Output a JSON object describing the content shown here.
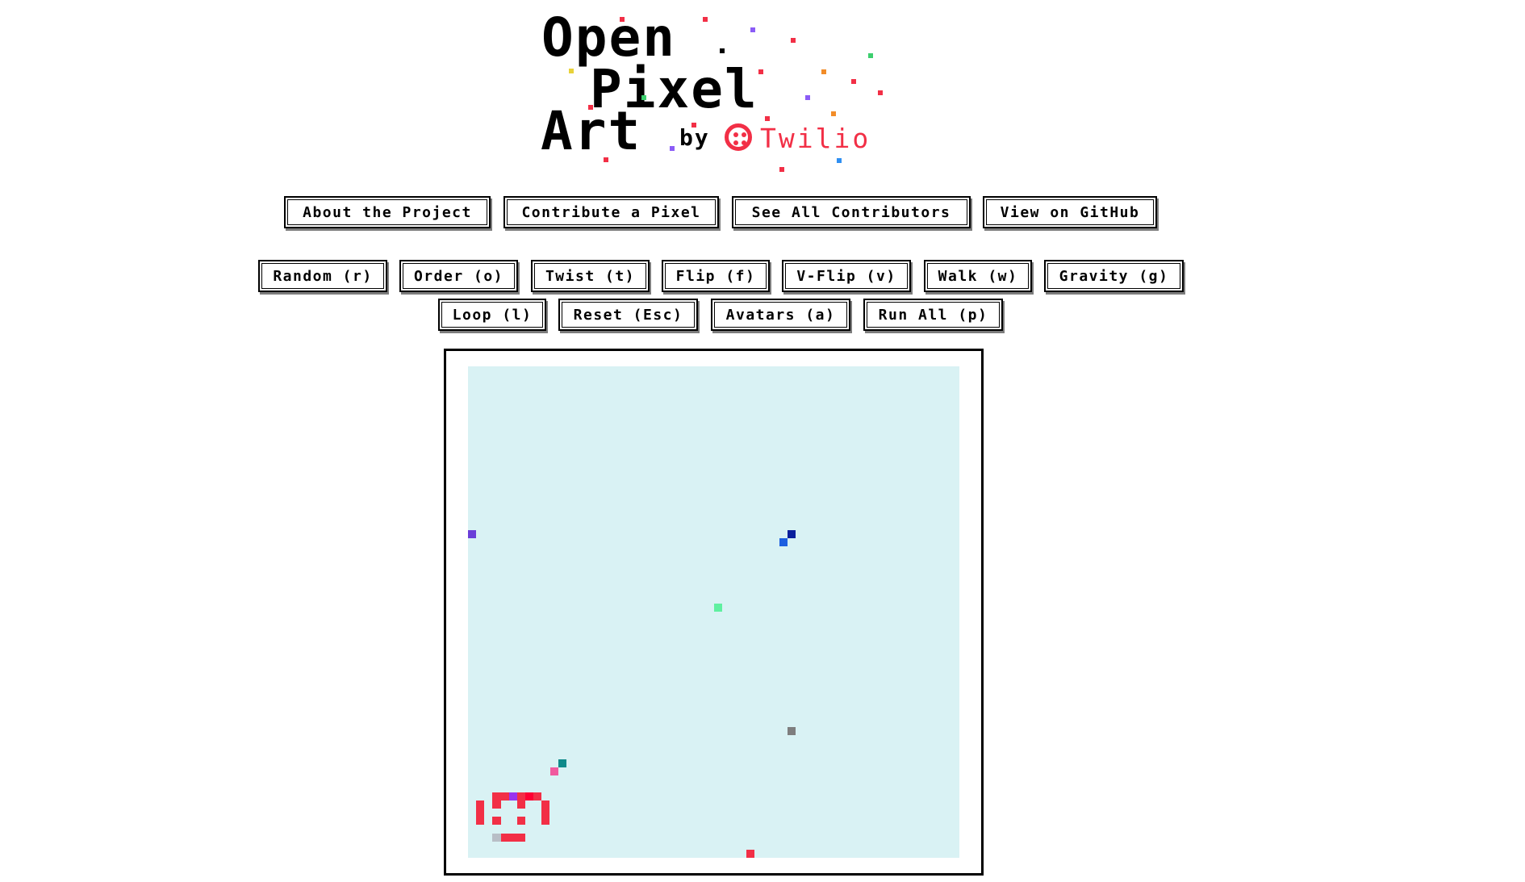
{
  "logo": {
    "line1": "Open",
    "line2": "Pixel",
    "line3": "Art",
    "by": "by",
    "brand": "Twilio",
    "brand_color": "#f22f46",
    "brand_icon": "twilio-logo-icon"
  },
  "nav": {
    "about": "About the Project",
    "contribute": "Contribute a Pixel",
    "contributors": "See All Contributors",
    "github": "View on GitHub"
  },
  "controls": {
    "random": "Random (r)",
    "order": "Order (o)",
    "twist": "Twist (t)",
    "flip": "Flip (f)",
    "vflip": "V-Flip (v)",
    "walk": "Walk (w)",
    "gravity": "Gravity (g)",
    "loop": "Loop (l)",
    "reset": "Reset (Esc)",
    "avatars": "Avatars (a)",
    "run_all": "Run All (p)"
  },
  "canvas": {
    "background": "#d9f2f4",
    "grid_cells": 60,
    "pixels": [
      {
        "col": 0,
        "row": 20,
        "color": "#6a3fd8"
      },
      {
        "col": 39,
        "row": 20,
        "color": "#0a1f9c"
      },
      {
        "col": 38,
        "row": 21,
        "color": "#1c5fe0"
      },
      {
        "col": 30,
        "row": 29,
        "color": "#5ff0a0"
      },
      {
        "col": 39,
        "row": 44,
        "color": "#7e7e7e"
      },
      {
        "col": 11,
        "row": 48,
        "color": "#0f8a8a"
      },
      {
        "col": 10,
        "row": 49,
        "color": "#f05a9e"
      },
      {
        "col": 3,
        "row": 52,
        "color": "#f22f46"
      },
      {
        "col": 4,
        "row": 52,
        "color": "#f22f46"
      },
      {
        "col": 5,
        "row": 52,
        "color": "#9933ee"
      },
      {
        "col": 6,
        "row": 52,
        "color": "#f22f46"
      },
      {
        "col": 7,
        "row": 52,
        "color": "#ff0033"
      },
      {
        "col": 8,
        "row": 52,
        "color": "#f22f46"
      },
      {
        "col": 1,
        "row": 53,
        "color": "#f22f46"
      },
      {
        "col": 3,
        "row": 53,
        "color": "#f22f46"
      },
      {
        "col": 6,
        "row": 53,
        "color": "#f22f46"
      },
      {
        "col": 9,
        "row": 53,
        "color": "#f22f46"
      },
      {
        "col": 1,
        "row": 54,
        "color": "#f22f46"
      },
      {
        "col": 9,
        "row": 54,
        "color": "#f22f46"
      },
      {
        "col": 1,
        "row": 55,
        "color": "#f22f46"
      },
      {
        "col": 3,
        "row": 55,
        "color": "#f22f46"
      },
      {
        "col": 6,
        "row": 55,
        "color": "#f22f46"
      },
      {
        "col": 9,
        "row": 55,
        "color": "#f22f46"
      },
      {
        "col": 3,
        "row": 57,
        "color": "#b8bec6"
      },
      {
        "col": 4,
        "row": 57,
        "color": "#f22f46"
      },
      {
        "col": 5,
        "row": 57,
        "color": "#f22f46"
      },
      {
        "col": 6,
        "row": 57,
        "color": "#f22f46"
      },
      {
        "col": 34,
        "row": 59,
        "color": "#f22f46"
      }
    ]
  }
}
